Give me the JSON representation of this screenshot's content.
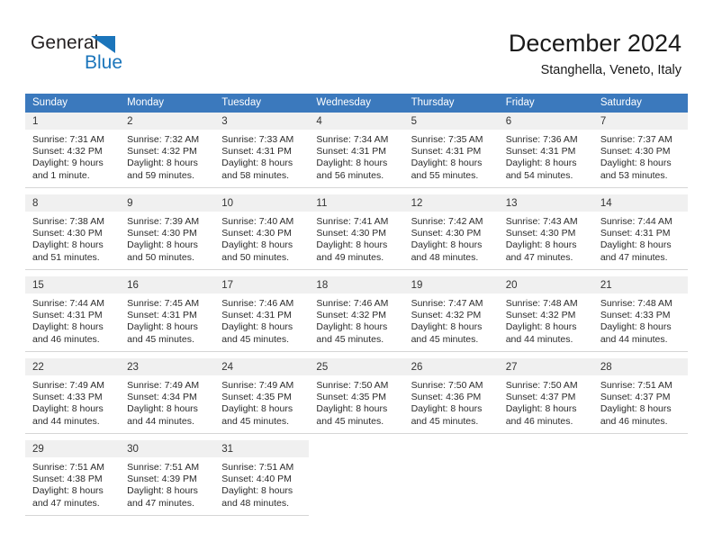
{
  "logo": {
    "primary_text": "General",
    "secondary_text": "Blue",
    "primary_color": "#231f20",
    "secondary_color": "#1b75bb",
    "icon": "triangle-icon"
  },
  "header": {
    "title": "December 2024",
    "subtitle": "Stanghella, Veneto, Italy"
  },
  "colors": {
    "header_row_bg": "#3b79bd",
    "header_row_text": "#ffffff",
    "daynum_bg": "#f0f0f0",
    "cell_border": "#d6d6d6"
  },
  "weekday_headers": [
    "Sunday",
    "Monday",
    "Tuesday",
    "Wednesday",
    "Thursday",
    "Friday",
    "Saturday"
  ],
  "weeks": [
    [
      {
        "day": "1",
        "sunrise": "Sunrise: 7:31 AM",
        "sunset": "Sunset: 4:32 PM",
        "daylight_line1": "Daylight: 9 hours",
        "daylight_line2": "and 1 minute."
      },
      {
        "day": "2",
        "sunrise": "Sunrise: 7:32 AM",
        "sunset": "Sunset: 4:32 PM",
        "daylight_line1": "Daylight: 8 hours",
        "daylight_line2": "and 59 minutes."
      },
      {
        "day": "3",
        "sunrise": "Sunrise: 7:33 AM",
        "sunset": "Sunset: 4:31 PM",
        "daylight_line1": "Daylight: 8 hours",
        "daylight_line2": "and 58 minutes."
      },
      {
        "day": "4",
        "sunrise": "Sunrise: 7:34 AM",
        "sunset": "Sunset: 4:31 PM",
        "daylight_line1": "Daylight: 8 hours",
        "daylight_line2": "and 56 minutes."
      },
      {
        "day": "5",
        "sunrise": "Sunrise: 7:35 AM",
        "sunset": "Sunset: 4:31 PM",
        "daylight_line1": "Daylight: 8 hours",
        "daylight_line2": "and 55 minutes."
      },
      {
        "day": "6",
        "sunrise": "Sunrise: 7:36 AM",
        "sunset": "Sunset: 4:31 PM",
        "daylight_line1": "Daylight: 8 hours",
        "daylight_line2": "and 54 minutes."
      },
      {
        "day": "7",
        "sunrise": "Sunrise: 7:37 AM",
        "sunset": "Sunset: 4:30 PM",
        "daylight_line1": "Daylight: 8 hours",
        "daylight_line2": "and 53 minutes."
      }
    ],
    [
      {
        "day": "8",
        "sunrise": "Sunrise: 7:38 AM",
        "sunset": "Sunset: 4:30 PM",
        "daylight_line1": "Daylight: 8 hours",
        "daylight_line2": "and 51 minutes."
      },
      {
        "day": "9",
        "sunrise": "Sunrise: 7:39 AM",
        "sunset": "Sunset: 4:30 PM",
        "daylight_line1": "Daylight: 8 hours",
        "daylight_line2": "and 50 minutes."
      },
      {
        "day": "10",
        "sunrise": "Sunrise: 7:40 AM",
        "sunset": "Sunset: 4:30 PM",
        "daylight_line1": "Daylight: 8 hours",
        "daylight_line2": "and 50 minutes."
      },
      {
        "day": "11",
        "sunrise": "Sunrise: 7:41 AM",
        "sunset": "Sunset: 4:30 PM",
        "daylight_line1": "Daylight: 8 hours",
        "daylight_line2": "and 49 minutes."
      },
      {
        "day": "12",
        "sunrise": "Sunrise: 7:42 AM",
        "sunset": "Sunset: 4:30 PM",
        "daylight_line1": "Daylight: 8 hours",
        "daylight_line2": "and 48 minutes."
      },
      {
        "day": "13",
        "sunrise": "Sunrise: 7:43 AM",
        "sunset": "Sunset: 4:30 PM",
        "daylight_line1": "Daylight: 8 hours",
        "daylight_line2": "and 47 minutes."
      },
      {
        "day": "14",
        "sunrise": "Sunrise: 7:44 AM",
        "sunset": "Sunset: 4:31 PM",
        "daylight_line1": "Daylight: 8 hours",
        "daylight_line2": "and 47 minutes."
      }
    ],
    [
      {
        "day": "15",
        "sunrise": "Sunrise: 7:44 AM",
        "sunset": "Sunset: 4:31 PM",
        "daylight_line1": "Daylight: 8 hours",
        "daylight_line2": "and 46 minutes."
      },
      {
        "day": "16",
        "sunrise": "Sunrise: 7:45 AM",
        "sunset": "Sunset: 4:31 PM",
        "daylight_line1": "Daylight: 8 hours",
        "daylight_line2": "and 45 minutes."
      },
      {
        "day": "17",
        "sunrise": "Sunrise: 7:46 AM",
        "sunset": "Sunset: 4:31 PM",
        "daylight_line1": "Daylight: 8 hours",
        "daylight_line2": "and 45 minutes."
      },
      {
        "day": "18",
        "sunrise": "Sunrise: 7:46 AM",
        "sunset": "Sunset: 4:32 PM",
        "daylight_line1": "Daylight: 8 hours",
        "daylight_line2": "and 45 minutes."
      },
      {
        "day": "19",
        "sunrise": "Sunrise: 7:47 AM",
        "sunset": "Sunset: 4:32 PM",
        "daylight_line1": "Daylight: 8 hours",
        "daylight_line2": "and 45 minutes."
      },
      {
        "day": "20",
        "sunrise": "Sunrise: 7:48 AM",
        "sunset": "Sunset: 4:32 PM",
        "daylight_line1": "Daylight: 8 hours",
        "daylight_line2": "and 44 minutes."
      },
      {
        "day": "21",
        "sunrise": "Sunrise: 7:48 AM",
        "sunset": "Sunset: 4:33 PM",
        "daylight_line1": "Daylight: 8 hours",
        "daylight_line2": "and 44 minutes."
      }
    ],
    [
      {
        "day": "22",
        "sunrise": "Sunrise: 7:49 AM",
        "sunset": "Sunset: 4:33 PM",
        "daylight_line1": "Daylight: 8 hours",
        "daylight_line2": "and 44 minutes."
      },
      {
        "day": "23",
        "sunrise": "Sunrise: 7:49 AM",
        "sunset": "Sunset: 4:34 PM",
        "daylight_line1": "Daylight: 8 hours",
        "daylight_line2": "and 44 minutes."
      },
      {
        "day": "24",
        "sunrise": "Sunrise: 7:49 AM",
        "sunset": "Sunset: 4:35 PM",
        "daylight_line1": "Daylight: 8 hours",
        "daylight_line2": "and 45 minutes."
      },
      {
        "day": "25",
        "sunrise": "Sunrise: 7:50 AM",
        "sunset": "Sunset: 4:35 PM",
        "daylight_line1": "Daylight: 8 hours",
        "daylight_line2": "and 45 minutes."
      },
      {
        "day": "26",
        "sunrise": "Sunrise: 7:50 AM",
        "sunset": "Sunset: 4:36 PM",
        "daylight_line1": "Daylight: 8 hours",
        "daylight_line2": "and 45 minutes."
      },
      {
        "day": "27",
        "sunrise": "Sunrise: 7:50 AM",
        "sunset": "Sunset: 4:37 PM",
        "daylight_line1": "Daylight: 8 hours",
        "daylight_line2": "and 46 minutes."
      },
      {
        "day": "28",
        "sunrise": "Sunrise: 7:51 AM",
        "sunset": "Sunset: 4:37 PM",
        "daylight_line1": "Daylight: 8 hours",
        "daylight_line2": "and 46 minutes."
      }
    ],
    [
      {
        "day": "29",
        "sunrise": "Sunrise: 7:51 AM",
        "sunset": "Sunset: 4:38 PM",
        "daylight_line1": "Daylight: 8 hours",
        "daylight_line2": "and 47 minutes."
      },
      {
        "day": "30",
        "sunrise": "Sunrise: 7:51 AM",
        "sunset": "Sunset: 4:39 PM",
        "daylight_line1": "Daylight: 8 hours",
        "daylight_line2": "and 47 minutes."
      },
      {
        "day": "31",
        "sunrise": "Sunrise: 7:51 AM",
        "sunset": "Sunset: 4:40 PM",
        "daylight_line1": "Daylight: 8 hours",
        "daylight_line2": "and 48 minutes."
      },
      {
        "day": "",
        "sunrise": "",
        "sunset": "",
        "daylight_line1": "",
        "daylight_line2": ""
      },
      {
        "day": "",
        "sunrise": "",
        "sunset": "",
        "daylight_line1": "",
        "daylight_line2": ""
      },
      {
        "day": "",
        "sunrise": "",
        "sunset": "",
        "daylight_line1": "",
        "daylight_line2": ""
      },
      {
        "day": "",
        "sunrise": "",
        "sunset": "",
        "daylight_line1": "",
        "daylight_line2": ""
      }
    ]
  ]
}
